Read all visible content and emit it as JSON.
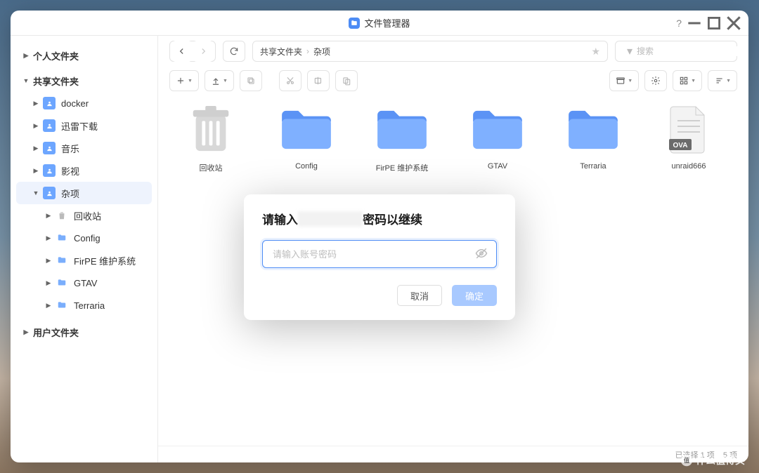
{
  "window": {
    "title": "文件管理器"
  },
  "sidebar": {
    "sections": [
      {
        "label": "个人文件夹"
      },
      {
        "label": "共享文件夹",
        "children": [
          {
            "label": "docker"
          },
          {
            "label": "迅雷下载"
          },
          {
            "label": "音乐"
          },
          {
            "label": "影视"
          },
          {
            "label": "杂项",
            "active": true,
            "children": [
              {
                "label": "回收站",
                "icon": "trash"
              },
              {
                "label": "Config",
                "icon": "folder"
              },
              {
                "label": "FirPE 维护系统",
                "icon": "folder"
              },
              {
                "label": "GTAV",
                "icon": "folder"
              },
              {
                "label": "Terraria",
                "icon": "folder"
              }
            ]
          }
        ]
      },
      {
        "label": "用户文件夹"
      }
    ]
  },
  "breadcrumb": {
    "segments": [
      "共享文件夹",
      "杂项"
    ]
  },
  "search": {
    "placeholder": "搜索"
  },
  "grid": {
    "items": [
      {
        "name": "回收站",
        "kind": "trash"
      },
      {
        "name": "Config",
        "kind": "folder"
      },
      {
        "name": "FirPE 维护系统",
        "kind": "folder"
      },
      {
        "name": "GTAV",
        "kind": "folder"
      },
      {
        "name": "Terraria",
        "kind": "folder"
      },
      {
        "name": "unraid666",
        "kind": "ova",
        "badge": "OVA"
      }
    ]
  },
  "modal": {
    "title_prefix": "请输入",
    "title_suffix": "密码以继续",
    "placeholder": "请输入账号密码",
    "cancel": "取消",
    "confirm": "确定"
  },
  "status": {
    "left": "已选择 1 项",
    "right": "5 项"
  },
  "watermark": "什么值得买"
}
